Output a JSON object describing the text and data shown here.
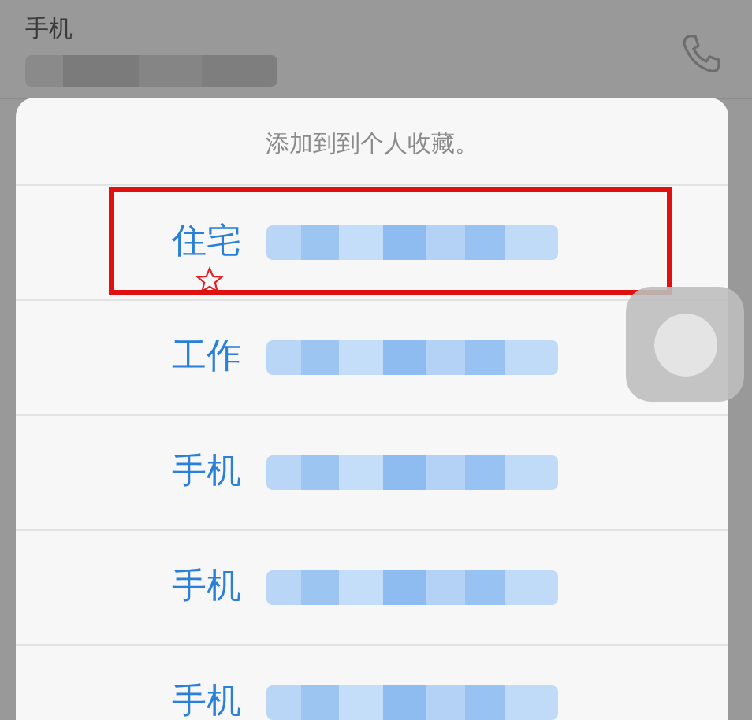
{
  "contact": {
    "label": "手机"
  },
  "sheet": {
    "title": "添加到到个人收藏。",
    "rows": [
      {
        "label": "住宅",
        "highlighted": true,
        "starred": true
      },
      {
        "label": "工作",
        "highlighted": false,
        "starred": false
      },
      {
        "label": "手机",
        "highlighted": false,
        "starred": false
      },
      {
        "label": "手机",
        "highlighted": false,
        "starred": false
      },
      {
        "label": "手机",
        "highlighted": false,
        "starred": false
      }
    ]
  }
}
